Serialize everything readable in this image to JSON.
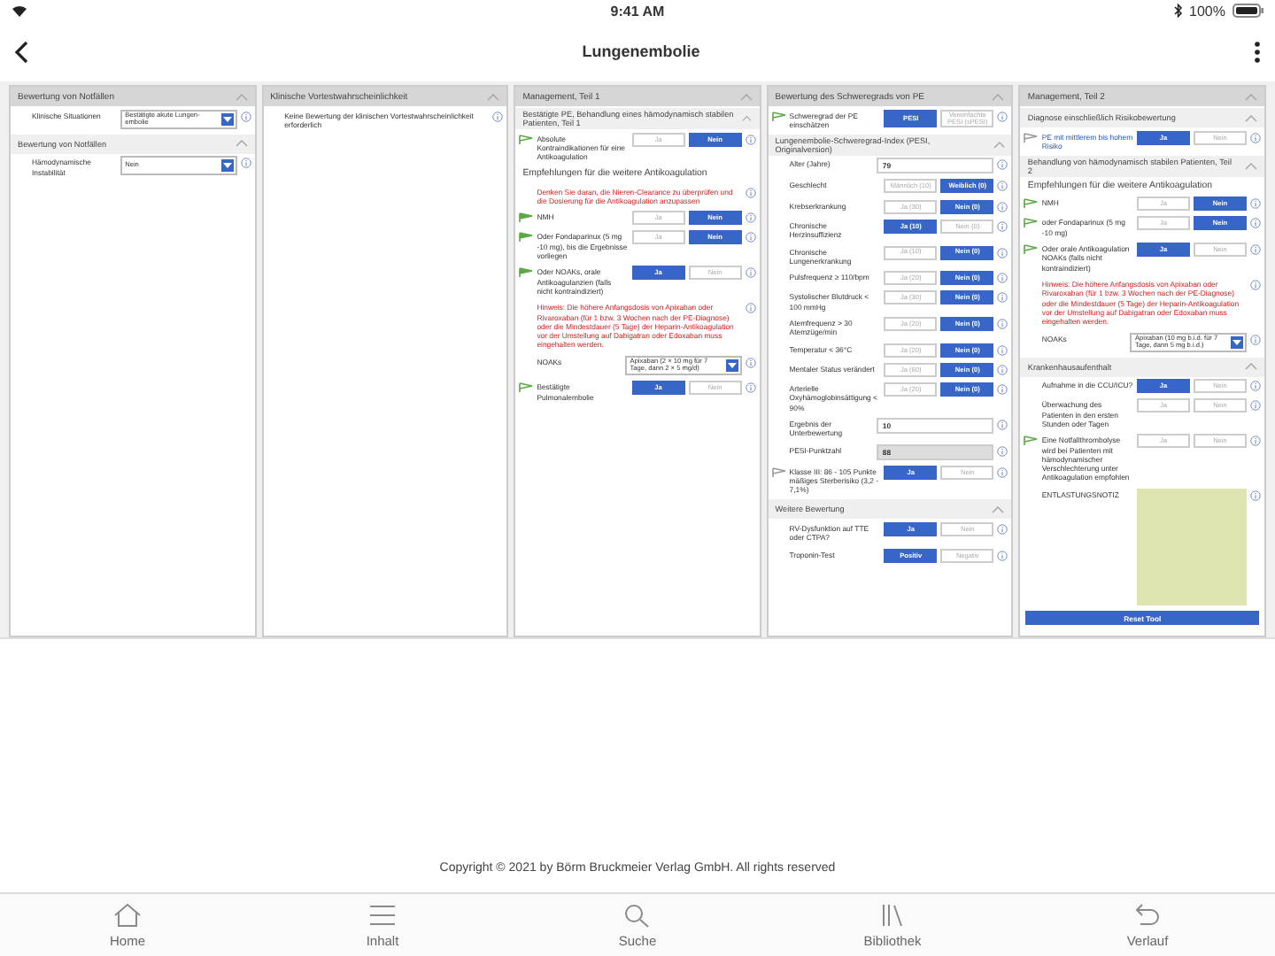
{
  "status_bar": {
    "time": "9:41 AM",
    "battery": "100%"
  },
  "header": {
    "title": "Lungenembolie"
  },
  "panels": [
    {
      "title": "Bewertung von Notfällen",
      "sections": [
        {
          "rows": [
            {
              "kind": "select",
              "label": "Klinische Situationen",
              "value": "Bestätigte akute Lungen-embolie"
            }
          ]
        },
        {
          "title": "Bewertung von Notfällen",
          "rows": [
            {
              "kind": "select",
              "label": "Hämodynamische Instabilität",
              "value": "Nein"
            }
          ]
        }
      ]
    },
    {
      "title": "Klinische Vortestwahrscheinlichkeit",
      "sections": [
        {
          "rows": [
            {
              "kind": "note",
              "alert": false,
              "text": "Keine Bewertung der klinischen Vortestwahrscheinlichkeit erforderlich"
            }
          ]
        }
      ]
    },
    {
      "title": "Management, Teil 1",
      "sections": [
        {
          "title": "Bestätigte PE, Behandlung eines hämodynamisch stabilen Patienten, Teil 1",
          "rows": [
            {
              "kind": "choice",
              "flag": {
                "color": "#5ba845",
                "filled": false
              },
              "label": "Absolute Kontraindikationen für eine Antikoagulation",
              "options": [
                {
                  "label": "Ja",
                  "selected": false
                },
                {
                  "label": "Nein",
                  "selected": true
                }
              ]
            },
            {
              "kind": "heading",
              "text": "Empfehlungen für die weitere Antikoagulation"
            },
            {
              "kind": "note",
              "alert": true,
              "text": "Denken Sie daran, die Nieren-Clearance zu überprüfen und die Dosierung für die Antikoagulation anzupassen"
            },
            {
              "kind": "choice",
              "flag": {
                "color": "#5ba845",
                "filled": true
              },
              "label": "NMH",
              "options": [
                {
                  "label": "Ja",
                  "selected": false
                },
                {
                  "label": "Nein",
                  "selected": true
                }
              ]
            },
            {
              "kind": "choice",
              "flag": {
                "color": "#5ba845",
                "filled": true
              },
              "label": "Oder Fondaparinux (5 mg -10 mg), bis die Ergebnisse vorliegen",
              "options": [
                {
                  "label": "Ja",
                  "selected": false
                },
                {
                  "label": "Nein",
                  "selected": true
                }
              ]
            },
            {
              "kind": "choice",
              "flag": {
                "color": "#5ba845",
                "filled": true
              },
              "label": "Oder NOAKs, orale Antikoagulanzien (falls nicht kontraindiziert)",
              "options": [
                {
                  "label": "Ja",
                  "selected": true
                },
                {
                  "label": "Nein",
                  "selected": false
                }
              ]
            },
            {
              "kind": "note",
              "alert": true,
              "text": "Hinweis: Die höhere Anfangsdosis von Apixaban oder Rivaroxaban (für 1 bzw. 3 Wochen nach der PE-Diagnose) oder die Mindestdauer (5 Tage) der Heparin-Antikoagulation vor der Umstellung auf Dabigatran oder Edoxaban muss eingehalten werden."
            },
            {
              "kind": "select",
              "label": "NOAKs",
              "value": "Apixaban (2 × 10 mg für 7 Tage, dann 2 × 5 mg/d)"
            },
            {
              "kind": "choice",
              "flag": {
                "color": "#5ba845",
                "filled": false
              },
              "label": "Bestätigte Pulmonalembolie",
              "options": [
                {
                  "label": "Ja",
                  "selected": true
                },
                {
                  "label": "Nein",
                  "selected": false
                }
              ]
            }
          ]
        }
      ]
    },
    {
      "title": "Bewertung des Schweregrads von PE",
      "sections": [
        {
          "rows": [
            {
              "kind": "choice",
              "flag": {
                "color": "#5ba845",
                "filled": false
              },
              "label": "Schweregrad der PE einschätzen",
              "options": [
                {
                  "label": "PESI",
                  "selected": true
                },
                {
                  "label": "Vereinfachte PESI (sPESI)",
                  "selected": false
                }
              ]
            }
          ]
        },
        {
          "title": "Lungenembolie-Schweregrad-Index (PESI, Originalversion)",
          "rows": [
            {
              "kind": "input",
              "label": "Alter (Jahre)",
              "value": "79"
            },
            {
              "kind": "choice",
              "label": "Geschlecht",
              "options": [
                {
                  "label": "Männlich (10)",
                  "selected": false
                },
                {
                  "label": "Weiblich (0)",
                  "selected": true
                }
              ]
            },
            {
              "kind": "choice",
              "label": "Krebserkrankung",
              "options": [
                {
                  "label": "Ja (30)",
                  "selected": false
                },
                {
                  "label": "Nein (0)",
                  "selected": true
                }
              ]
            },
            {
              "kind": "choice",
              "label": "Chronische Herzinsuffizienz",
              "options": [
                {
                  "label": "Ja (10)",
                  "selected": true
                },
                {
                  "label": "Nein (0)",
                  "selected": false
                }
              ]
            },
            {
              "kind": "choice",
              "label": "Chronische Lungenerkrankung",
              "options": [
                {
                  "label": "Ja (10)",
                  "selected": false
                },
                {
                  "label": "Nein (0)",
                  "selected": true
                }
              ]
            },
            {
              "kind": "choice",
              "label": "Pulsfrequenz ≥ 110/bpm",
              "options": [
                {
                  "label": "Ja (20)",
                  "selected": false
                },
                {
                  "label": "Nein (0)",
                  "selected": true
                }
              ]
            },
            {
              "kind": "choice",
              "label": "Systolischer Blutdruck < 100 mmHg",
              "options": [
                {
                  "label": "Ja (30)",
                  "selected": false
                },
                {
                  "label": "Nein (0)",
                  "selected": true
                }
              ]
            },
            {
              "kind": "choice",
              "label": "Atemfrequenz > 30 Atemzüge/min",
              "options": [
                {
                  "label": "Ja (20)",
                  "selected": false
                },
                {
                  "label": "Nein (0)",
                  "selected": true
                }
              ]
            },
            {
              "kind": "choice",
              "label": "Temperatur < 36°C",
              "options": [
                {
                  "label": "Ja (20)",
                  "selected": false
                },
                {
                  "label": "Nein (0)",
                  "selected": true
                }
              ]
            },
            {
              "kind": "choice",
              "label": "Mentaler Status verändert",
              "options": [
                {
                  "label": "Ja (60)",
                  "selected": false
                },
                {
                  "label": "Nein (0)",
                  "selected": true
                }
              ]
            },
            {
              "kind": "choice",
              "label": "Arterielle Oxyhämoglobinsättigung < 90%",
              "options": [
                {
                  "label": "Ja (20)",
                  "selected": false
                },
                {
                  "label": "Nein (0)",
                  "selected": true
                }
              ]
            },
            {
              "kind": "input",
              "label": "Ergebnis der Unterbewertung",
              "value": "10"
            },
            {
              "kind": "readonly",
              "label": "PESI-Punktzahl",
              "value": "88"
            },
            {
              "kind": "choice",
              "flag": {
                "color": "#999999",
                "filled": false
              },
              "label": "Klasse III: 86 - 105 Punkte mäßiges Sterberisiko (3,2 - 7,1%)",
              "options": [
                {
                  "label": "Ja",
                  "selected": true
                },
                {
                  "label": "Nein",
                  "selected": false
                }
              ]
            }
          ]
        },
        {
          "title": "Weitere Bewertung",
          "rows": [
            {
              "kind": "choice",
              "label": "RV-Dysfunktion auf TTE oder CTPA?",
              "options": [
                {
                  "label": "Ja",
                  "selected": true
                },
                {
                  "label": "Nein",
                  "selected": false
                }
              ]
            },
            {
              "kind": "choice",
              "label": "Troponin-Test",
              "options": [
                {
                  "label": "Positiv",
                  "selected": true
                },
                {
                  "label": "Negativ",
                  "selected": false
                }
              ]
            }
          ]
        }
      ]
    },
    {
      "title": "Management, Teil 2",
      "sections": [
        {
          "title": "Diagnose einschließlich Risikobewertung",
          "rows": [
            {
              "kind": "choice",
              "flag": {
                "color": "#999999",
                "filled": false
              },
              "link": true,
              "label": "PE mit mittlerem bis hohem Risiko",
              "options": [
                {
                  "label": "Ja",
                  "selected": true
                },
                {
                  "label": "Nein",
                  "selected": false
                }
              ]
            }
          ]
        },
        {
          "title": "Behandlung von hämodynamisch stabilen Patienten, Teil 2",
          "rows": [
            {
              "kind": "heading",
              "text": "Empfehlungen für die weitere Antikoagulation"
            },
            {
              "kind": "choice",
              "flag": {
                "color": "#5ba845",
                "filled": false
              },
              "label": "NMH",
              "options": [
                {
                  "label": "Ja",
                  "selected": false
                },
                {
                  "label": "Nein",
                  "selected": true
                }
              ]
            },
            {
              "kind": "choice",
              "flag": {
                "color": "#5ba845",
                "filled": false
              },
              "label": "oder Fondaparinux (5 mg -10 mg)",
              "options": [
                {
                  "label": "Ja",
                  "selected": false
                },
                {
                  "label": "Nein",
                  "selected": true
                }
              ]
            },
            {
              "kind": "choice",
              "flag": {
                "color": "#5ba845",
                "filled": false
              },
              "label": "Oder orale Antikoagulation NOAKs (falls nicht kontraindiziert)",
              "options": [
                {
                  "label": "Ja",
                  "selected": true
                },
                {
                  "label": "Nein",
                  "selected": false
                }
              ]
            },
            {
              "kind": "note",
              "alert": true,
              "text": "Hinweis: Die höhere Anfangsdosis von Apixaban oder Rivaroxaban (für 1 bzw. 3 Wochen nach der PE-Diagnose) oder die Mindestdauer (5 Tage) der Heparin-Antikoagulation vor der Umstellung auf Dabigatran oder Edoxaban muss eingehalten werden."
            },
            {
              "kind": "select",
              "label": "NOAKs",
              "value": "Apixaban (10 mg b.i.d. für 7 Tage, dann 5 mg b.i.d.)"
            }
          ]
        },
        {
          "title": "Krankenhausaufenthalt",
          "rows": [
            {
              "kind": "choice",
              "label": "Aufnahme in die CCU/ICU?",
              "options": [
                {
                  "label": "Ja",
                  "selected": true
                },
                {
                  "label": "Nein",
                  "selected": false
                }
              ]
            },
            {
              "kind": "choice",
              "label": "Überwachung des Patienten in den ersten Stunden oder Tagen",
              "options": [
                {
                  "label": "Ja",
                  "selected": false
                },
                {
                  "label": "Nein",
                  "selected": false
                }
              ]
            },
            {
              "kind": "choice",
              "flag": {
                "color": "#5ba845",
                "filled": false
              },
              "label": "Eine Notfallthrombolyse wird bei Patienten mit hämodynamischer Verschlechterung unter Antikoagulation empfohlen",
              "options": [
                {
                  "label": "Ja",
                  "selected": false
                },
                {
                  "label": "Nein",
                  "selected": false
                }
              ]
            },
            {
              "kind": "textarea",
              "label": "ENTLASTUNGSNOTIZ"
            },
            {
              "kind": "button",
              "label": "Reset Tool"
            }
          ]
        }
      ]
    }
  ],
  "footer": {
    "copyright": "Copyright © 2021 by Börm Bruckmeier Verlag GmbH. All rights reserved"
  },
  "tabs": [
    {
      "label": "Home"
    },
    {
      "label": "Inhalt"
    },
    {
      "label": "Suche"
    },
    {
      "label": "Bibliothek"
    },
    {
      "label": "Verlauf"
    }
  ]
}
